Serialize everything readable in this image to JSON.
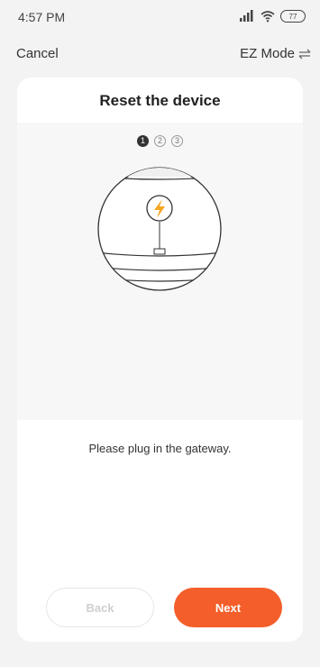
{
  "status_bar": {
    "time": "4:57 PM",
    "battery": "77",
    "icons": [
      "signal-icon",
      "wifi-icon",
      "battery-icon"
    ]
  },
  "header": {
    "cancel_label": "Cancel",
    "mode_label": "EZ Mode",
    "mode_icon": "swap-icon"
  },
  "card": {
    "title": "Reset the device",
    "steps": [
      "1",
      "2",
      "3"
    ],
    "active_step": 1,
    "illustration_icons": [
      "gateway-device-icon",
      "lightning-icon",
      "plug-port-icon"
    ],
    "instruction": "Please plug in the gateway.",
    "back_label": "Back",
    "next_label": "Next"
  },
  "colors": {
    "accent": "#f35e2a",
    "lightning": "#f5a623",
    "background": "#f3f3f3"
  }
}
